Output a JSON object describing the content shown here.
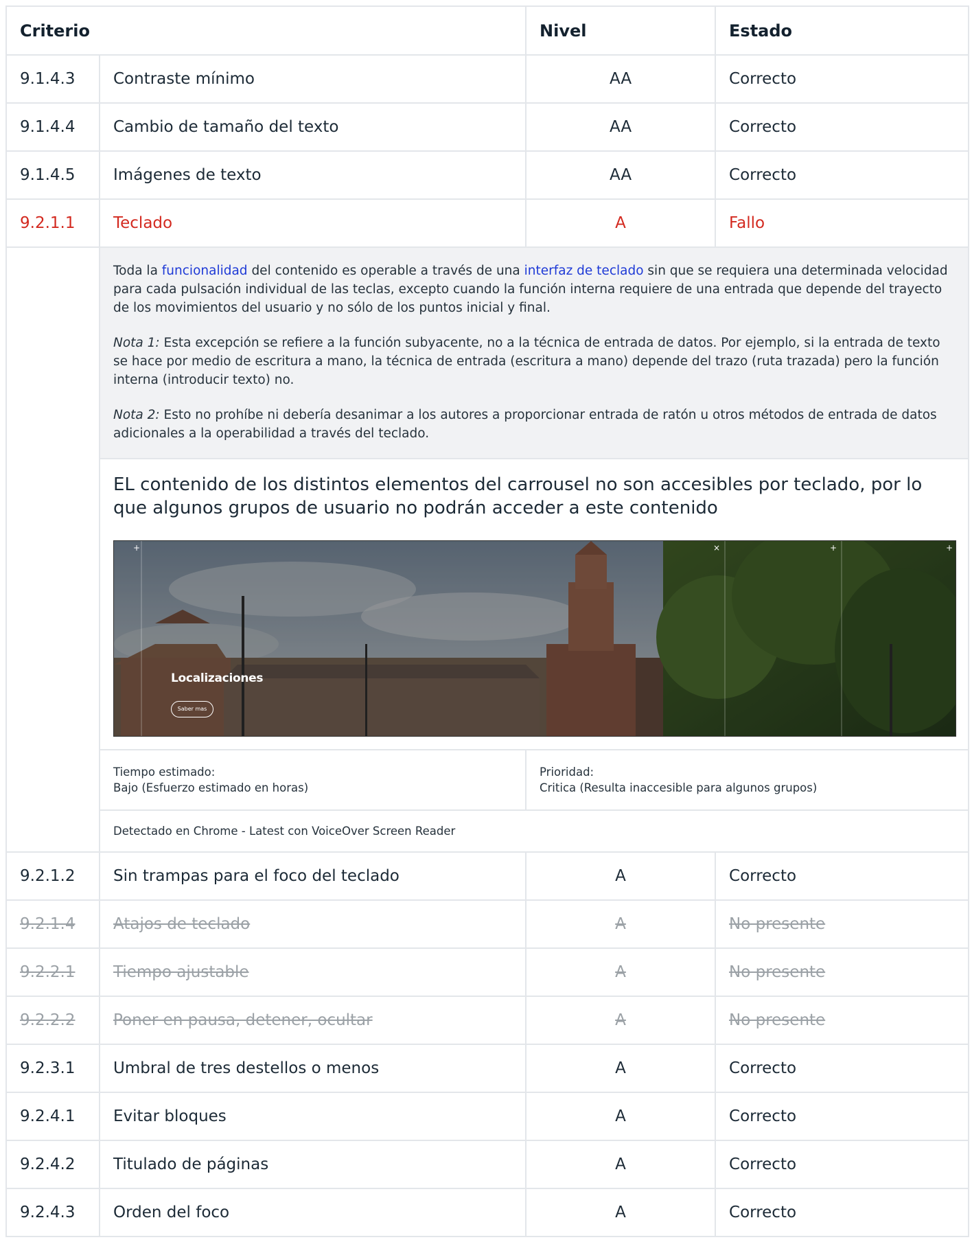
{
  "table": {
    "headers": {
      "criterio": "Criterio",
      "nivel": "Nivel",
      "estado": "Estado"
    },
    "rows_before": [
      {
        "code": "9.1.4.3",
        "name": "Contraste mínimo",
        "level": "AA",
        "status": "Correcto"
      },
      {
        "code": "9.1.4.4",
        "name": "Cambio de tamaño del texto",
        "level": "AA",
        "status": "Correcto"
      },
      {
        "code": "9.1.4.5",
        "name": "Imágenes de texto",
        "level": "AA",
        "status": "Correcto"
      }
    ],
    "failed_row": {
      "code": "9.2.1.1",
      "name": "Teclado",
      "level": "A",
      "status": "Fallo"
    },
    "rows_after": [
      {
        "code": "9.2.1.2",
        "name": "Sin trampas para el foco del teclado",
        "level": "A",
        "status": "Correcto"
      },
      {
        "code": "9.2.1.4",
        "name": "Atajos de teclado",
        "level": "A",
        "status": "No presente"
      },
      {
        "code": "9.2.2.1",
        "name": "Tiempo ajustable",
        "level": "A",
        "status": "No presente"
      },
      {
        "code": "9.2.2.2",
        "name": "Poner en pausa, detener, ocultar",
        "level": "A",
        "status": "No presente"
      },
      {
        "code": "9.2.3.1",
        "name": "Umbral de tres destellos o menos",
        "level": "A",
        "status": "Correcto"
      },
      {
        "code": "9.2.4.1",
        "name": "Evitar bloques",
        "level": "A",
        "status": "Correcto"
      },
      {
        "code": "9.2.4.2",
        "name": "Titulado de páginas",
        "level": "A",
        "status": "Correcto"
      },
      {
        "code": "9.2.4.3",
        "name": "Orden del foco",
        "level": "A",
        "status": "Correcto"
      }
    ]
  },
  "detail": {
    "definition": {
      "p1_before": "Toda la ",
      "link1": "funcionalidad",
      "p1_middle": " del contenido es operable a través de una ",
      "link2": "interfaz de teclado",
      "p1_after": " sin que se requiera una determinada velocidad para cada pulsación individual de las teclas, excepto cuando la función interna requiere de una entrada que depende del trayecto de los movimientos del usuario y no sólo de los puntos inicial y final.",
      "note1_label": "Nota 1:",
      "note1_text": " Esta excepción se refiere a la función subyacente, no a la técnica de entrada de datos. Por ejemplo, si la entrada de texto se hace por medio de escritura a mano, la técnica de entrada (escritura a mano) depende del trazo (ruta trazada) pero la función interna (introducir texto) no.",
      "note2_label": "Nota 2:",
      "note2_text": " Esto no prohíbe ni debería desanimar a los autores a proporcionar entrada de ratón u otros métodos de entrada de datos adicionales a la operabilidad a través del teclado."
    },
    "description": "EL contenido de los distintos elementos del carrousel no son accesibles por teclado, por lo que algunos grupos de usuario no podrán acceder a este contenido",
    "screenshot": {
      "title": "Localizaciones",
      "button": "Saber mas"
    },
    "time": {
      "label": "Tiempo estimado:",
      "value": "Bajo (Esfuerzo estimado en horas)"
    },
    "priority": {
      "label": "Prioridad:",
      "value": "Critica (Resulta inaccesible para algunos grupos)"
    },
    "detected": "Detectado en Chrome - Latest con VoiceOver Screen Reader"
  }
}
